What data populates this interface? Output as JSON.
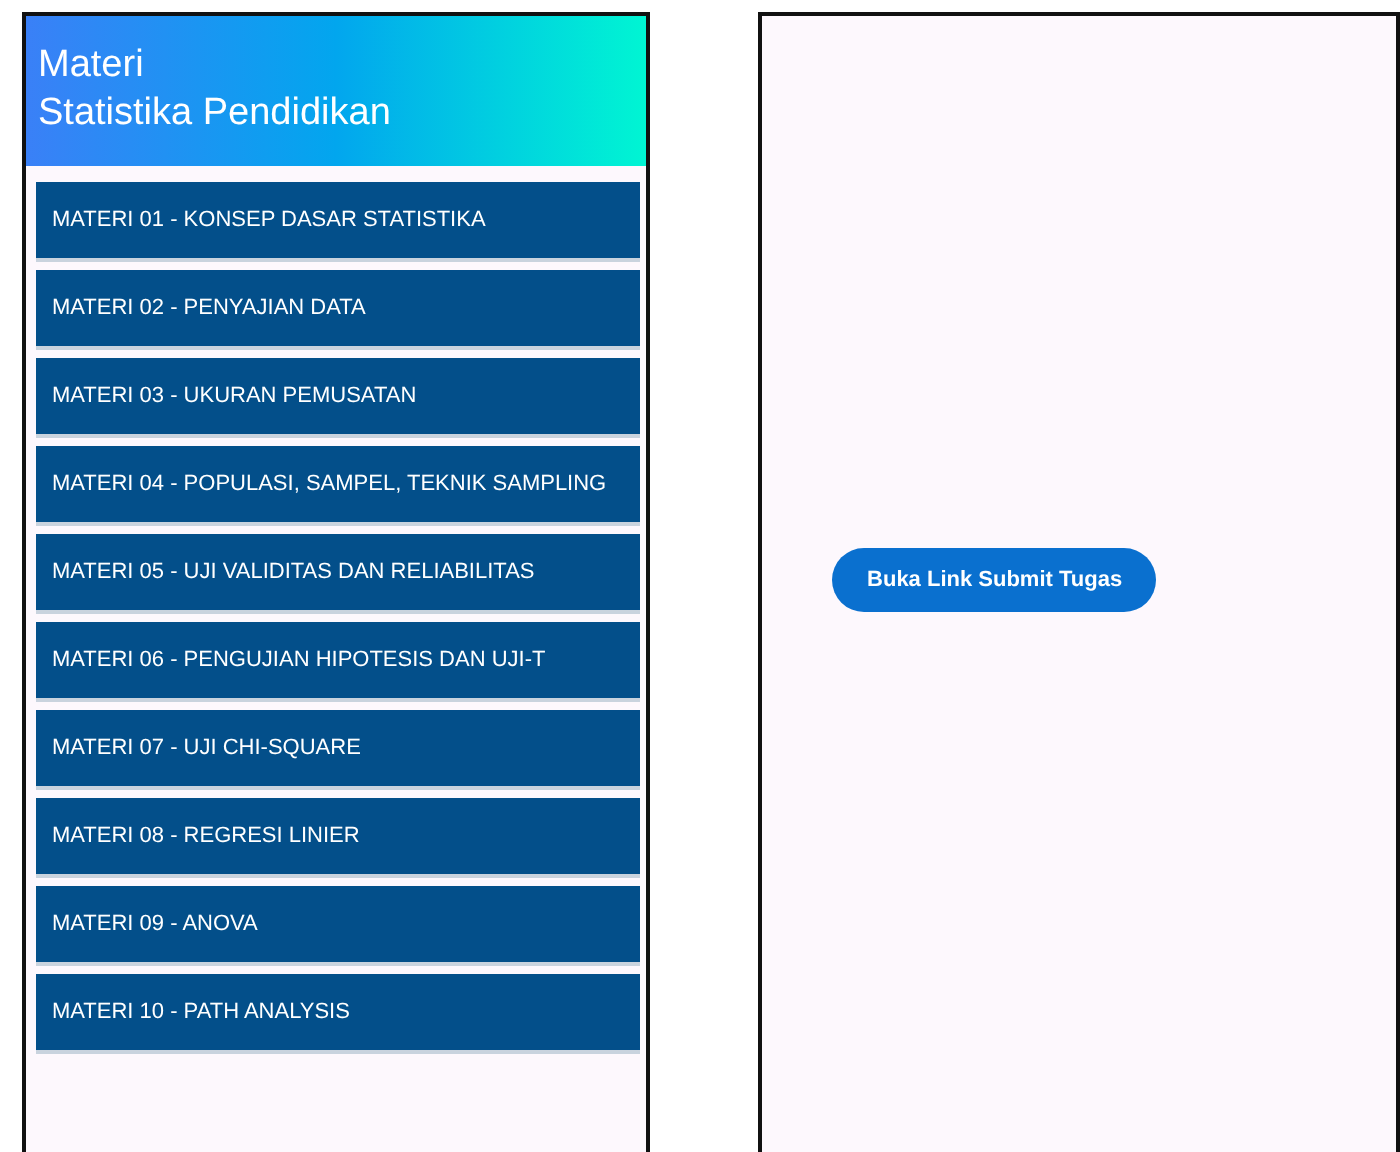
{
  "left_screen": {
    "header": {
      "title": "Materi\nStatistika Pendidikan"
    },
    "items": [
      {
        "label": "MATERI 01 - KONSEP DASAR STATISTIKA"
      },
      {
        "label": "MATERI 02 - PENYAJIAN DATA"
      },
      {
        "label": "MATERI 03 - UKURAN PEMUSATAN"
      },
      {
        "label": "MATERI 04 - POPULASI, SAMPEL, TEKNIK SAMPLING"
      },
      {
        "label": "MATERI 05 - UJI VALIDITAS DAN RELIABILITAS"
      },
      {
        "label": "MATERI 06 - PENGUJIAN HIPOTESIS DAN UJI-T"
      },
      {
        "label": "MATERI 07 - UJI CHI-SQUARE"
      },
      {
        "label": "MATERI 08 - REGRESI LINIER"
      },
      {
        "label": "MATERI 09 - ANOVA"
      },
      {
        "label": "MATERI 10 - PATH ANALYSIS"
      }
    ]
  },
  "right_screen": {
    "button": "Buka Link Submit Tugas"
  }
}
